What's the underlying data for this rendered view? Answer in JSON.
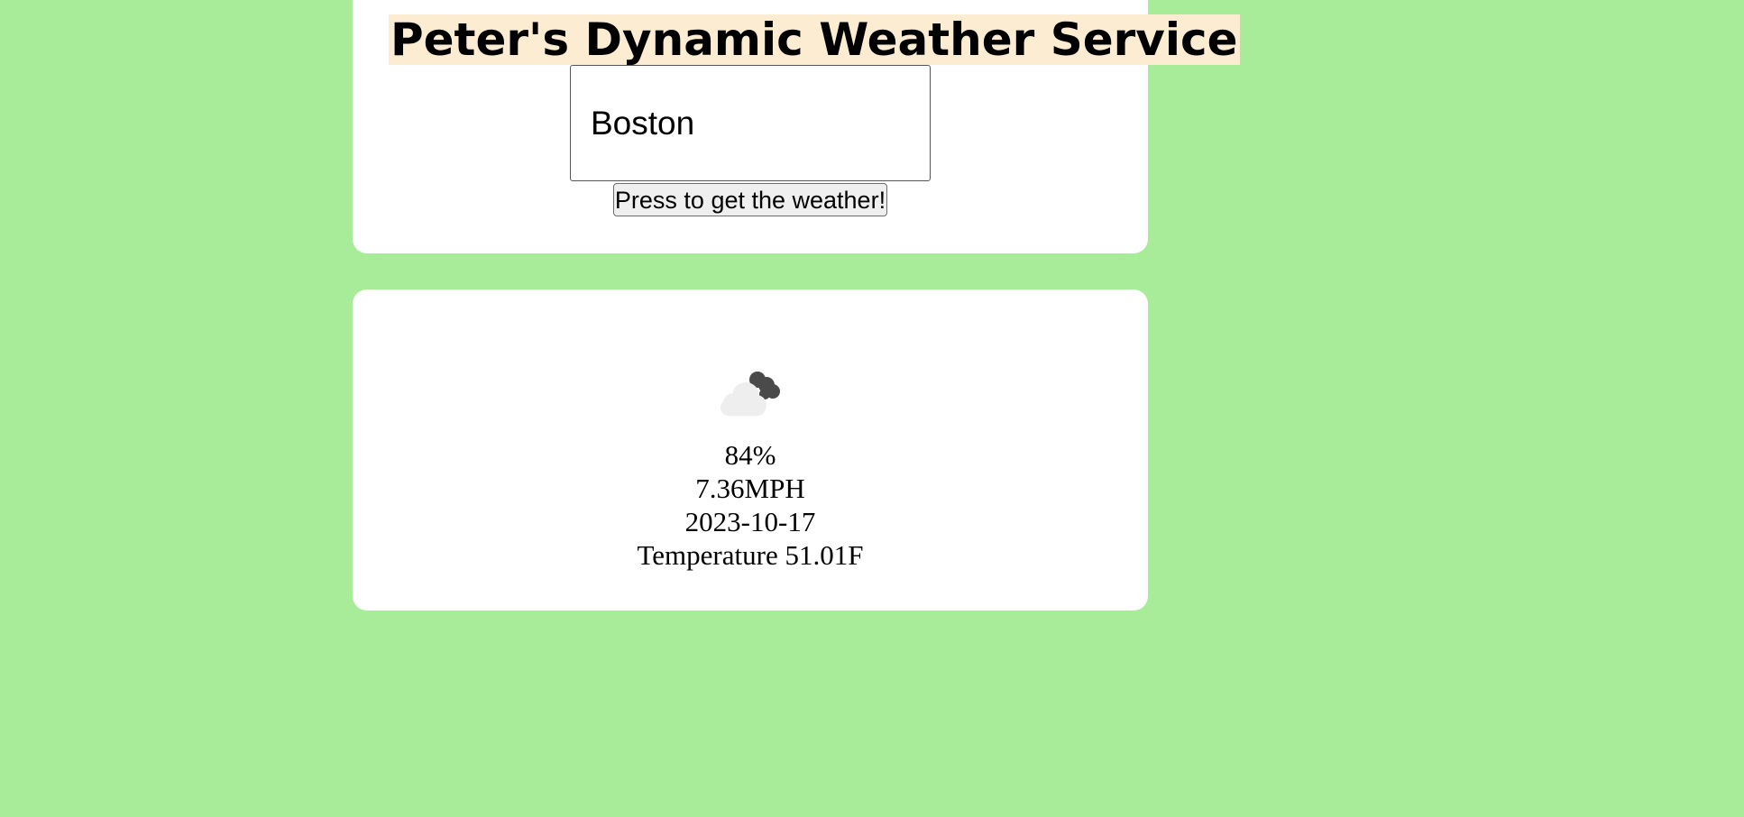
{
  "header": {
    "title": "Peter's Dynamic Weather Service"
  },
  "search": {
    "value": "Boston",
    "button_label": "Press to get the weather!"
  },
  "result": {
    "icon": "cloudy-sun-icon",
    "humidity": "84%",
    "wind": "7.36MPH",
    "date": "2023-10-17",
    "temperature": "Temperature 51.01F"
  },
  "colors": {
    "background": "#a8ec99",
    "card": "#ffffff",
    "title_highlight": "#fcecd2"
  }
}
